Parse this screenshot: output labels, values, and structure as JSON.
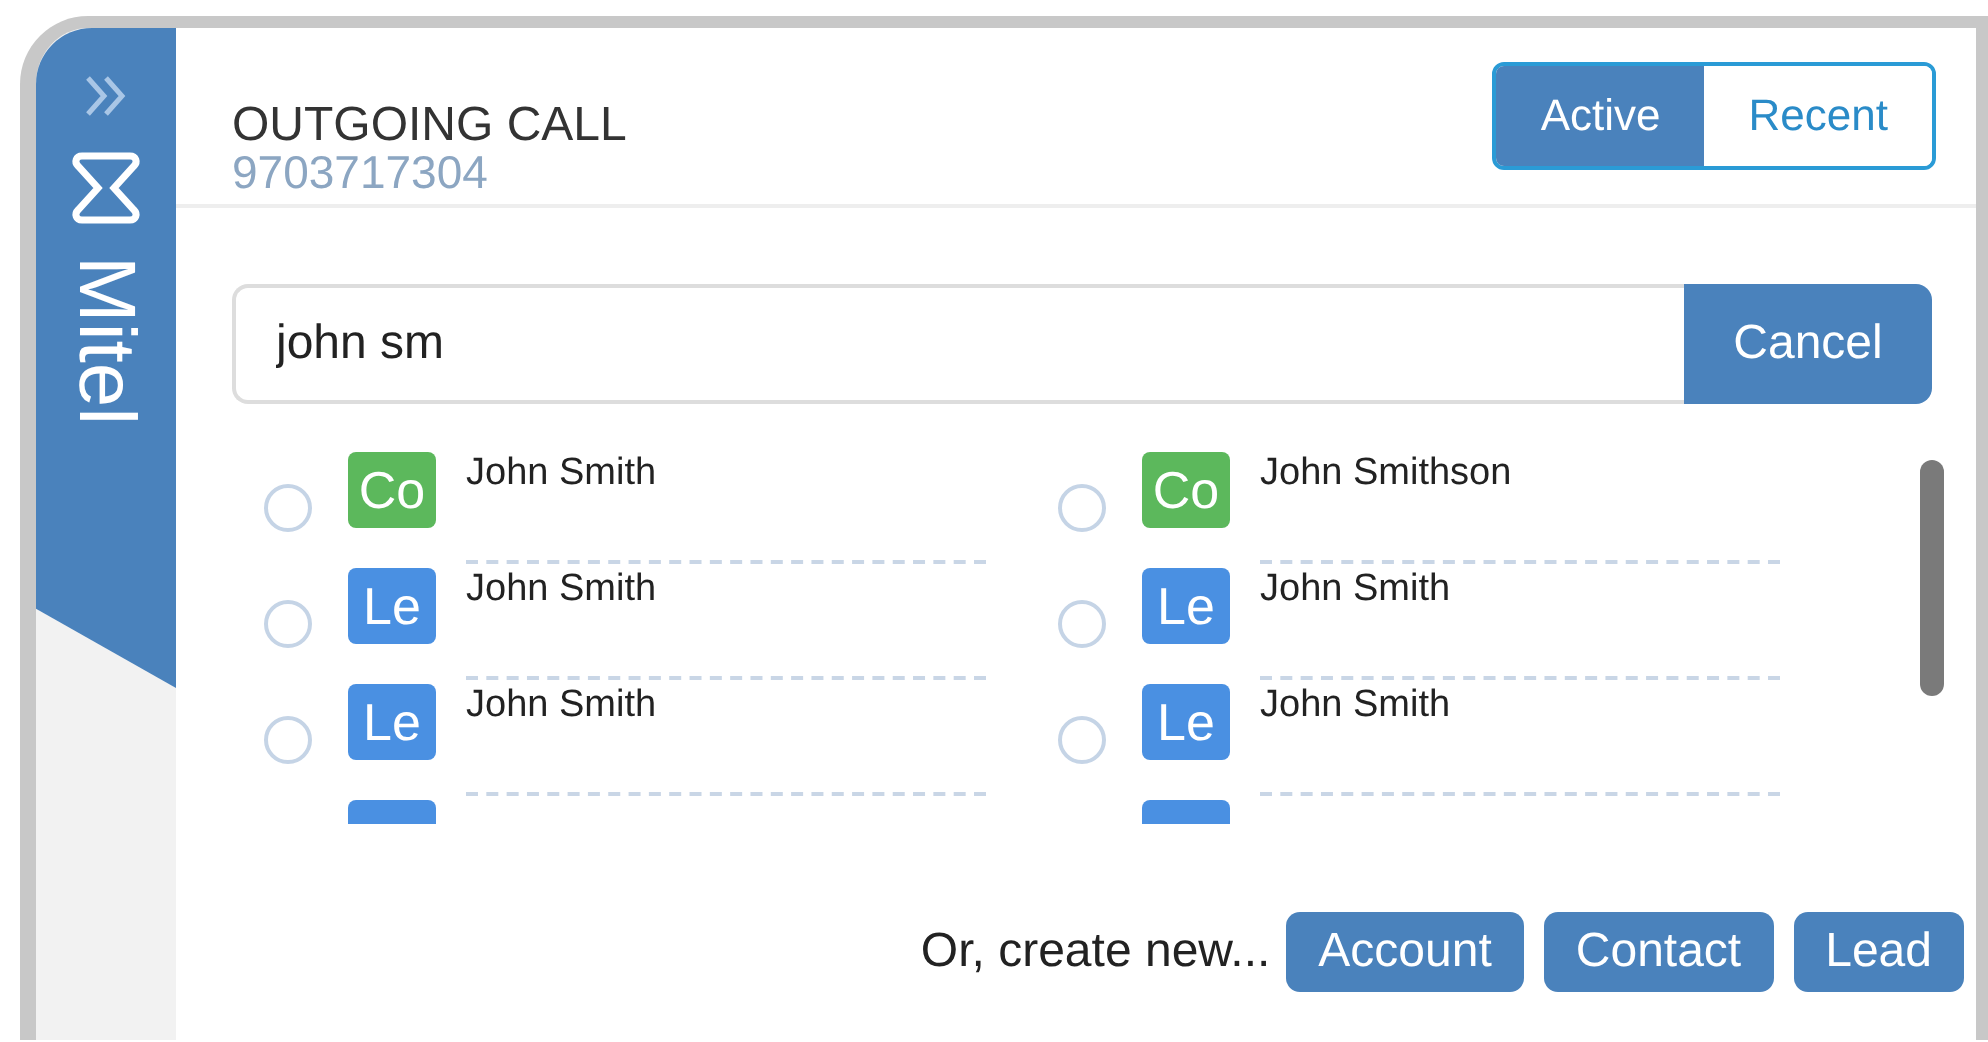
{
  "sidebar": {
    "brand": "Mitel"
  },
  "header": {
    "title": "OUTGOING CALL",
    "number": "9703717304",
    "tabs": [
      {
        "label": "Active",
        "selected": true
      },
      {
        "label": "Recent",
        "selected": false
      }
    ]
  },
  "search": {
    "value": "john sm",
    "button": "Cancel"
  },
  "results": [
    {
      "badge": "Co",
      "color": "#5cb85c",
      "name": "John Smith",
      "selected": false
    },
    {
      "badge": "Co",
      "color": "#5cb85c",
      "name": "John Smithson",
      "selected": false
    },
    {
      "badge": "Le",
      "color": "#4a90e2",
      "name": "John Smith",
      "selected": false
    },
    {
      "badge": "Le",
      "color": "#4a90e2",
      "name": "John Smith",
      "selected": false
    },
    {
      "badge": "Le",
      "color": "#4a90e2",
      "name": "John Smith",
      "selected": false
    },
    {
      "badge": "Le",
      "color": "#4a90e2",
      "name": "John Smith",
      "selected": false
    },
    {
      "kind": "partial",
      "color": "#4a90e2"
    },
    {
      "kind": "partial",
      "color": "#4a90e2"
    }
  ],
  "footer": {
    "prompt": "Or, create new...",
    "buttons": [
      "Account",
      "Contact",
      "Lead"
    ]
  }
}
